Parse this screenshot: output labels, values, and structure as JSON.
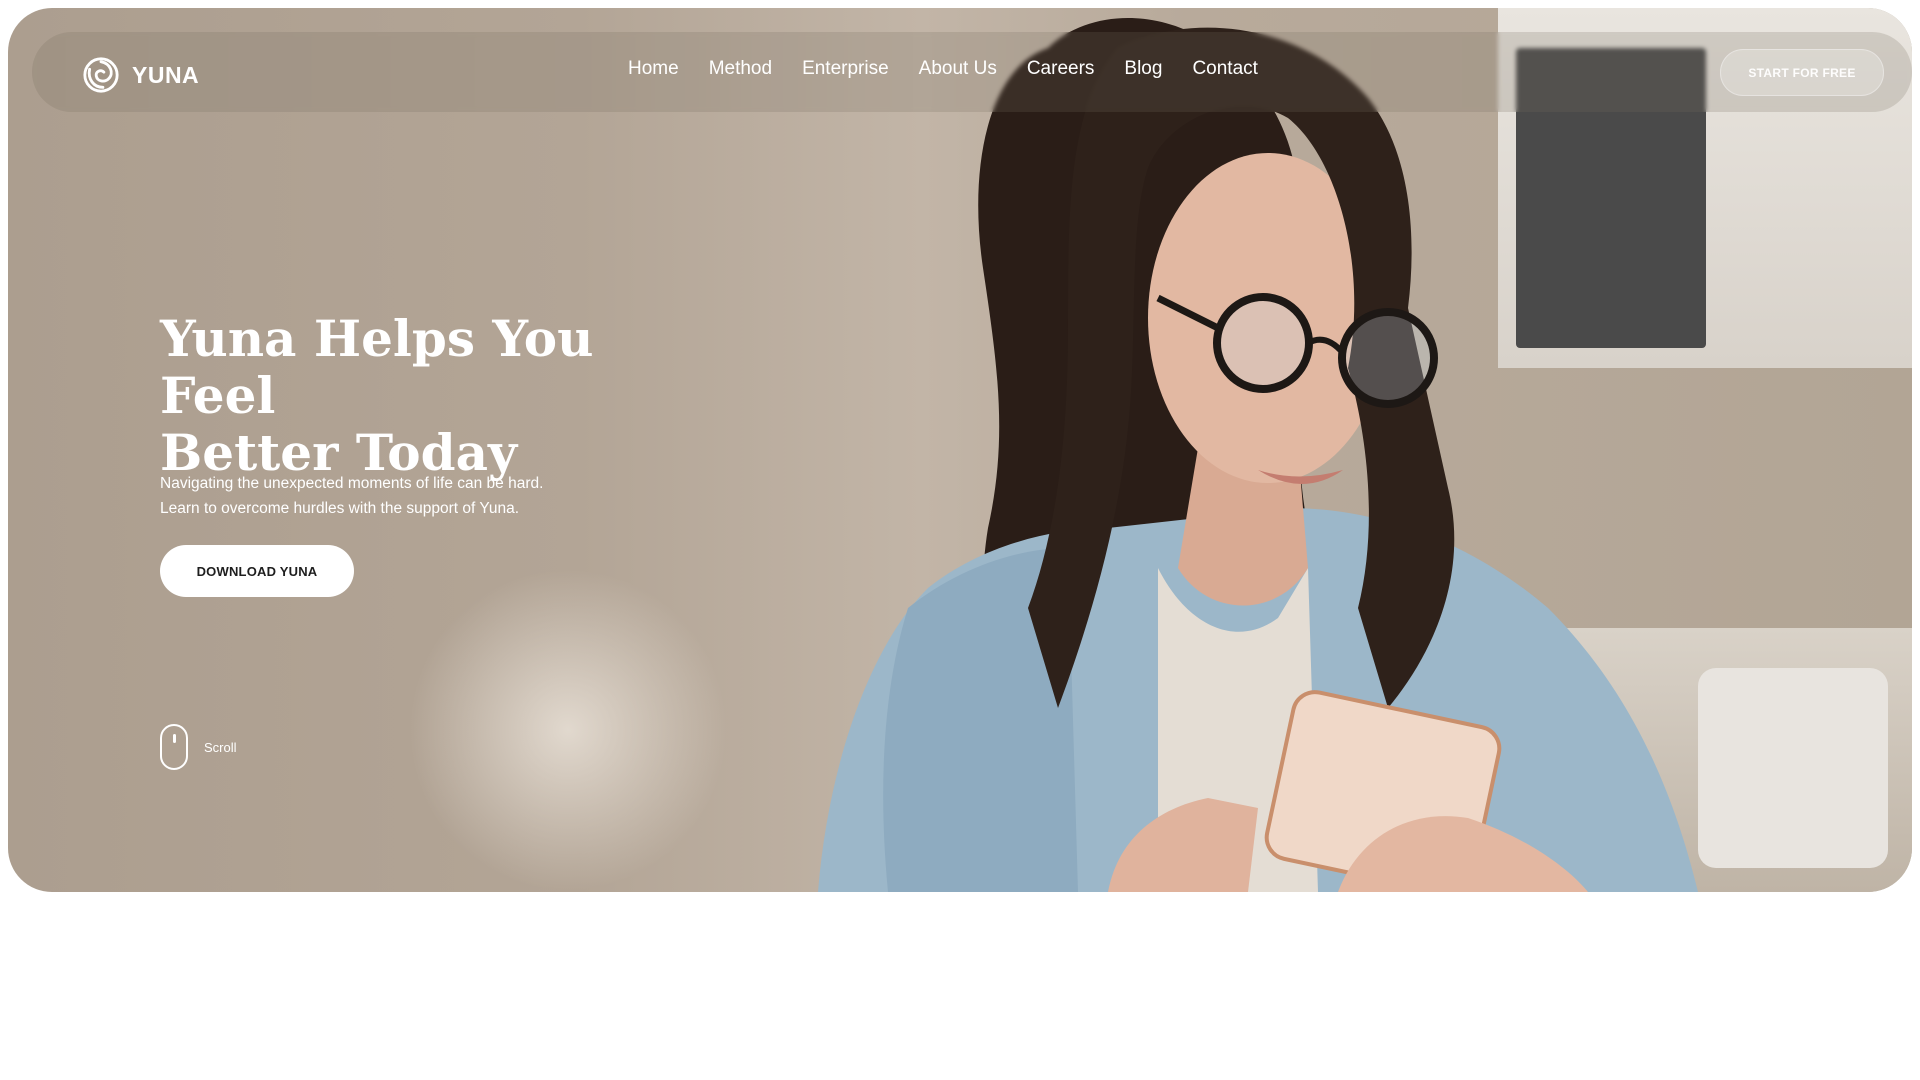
{
  "brand": {
    "name": "YUNA",
    "logo_icon": "swirl-logo-icon"
  },
  "nav": {
    "links": [
      "Home",
      "Method",
      "Enterprise",
      "About Us",
      "Careers",
      "Blog",
      "Contact"
    ],
    "cta_label": "START FOR FREE"
  },
  "hero": {
    "headline_line1": "Yuna Helps You Feel",
    "headline_line2": "Better Today",
    "subtext_line1": "Navigating the unexpected moments of life can be hard.",
    "subtext_line2": "Learn to overcome hurdles with the support of Yuna.",
    "download_label": "DOWNLOAD YUNA",
    "scroll_label": "Scroll",
    "scroll_icon": "mouse-icon"
  },
  "colors": {
    "hero_bg": "#b3a596",
    "text": "#ffffff",
    "button_bg": "#ffffff",
    "button_text": "#1e1e1e"
  }
}
